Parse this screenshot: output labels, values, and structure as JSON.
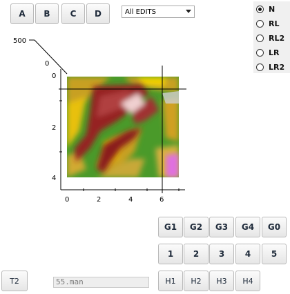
{
  "toolbar": {
    "buttons": [
      "A",
      "B",
      "C",
      "D"
    ]
  },
  "edits_dropdown": {
    "selected": "All EDITS"
  },
  "radio_group": {
    "options": [
      "N",
      "RL",
      "RL2",
      "LR",
      "LR2"
    ],
    "selected": "N"
  },
  "plot": {
    "z_label": "500",
    "z_zero": "0",
    "y_ticks": [
      "0",
      "2",
      "4"
    ],
    "x_ticks": [
      "0",
      "2",
      "4",
      "6"
    ]
  },
  "g_buttons": [
    "G1",
    "G2",
    "G3",
    "G4",
    "G0"
  ],
  "num_buttons": [
    "1",
    "2",
    "3",
    "4",
    "5"
  ],
  "h_buttons": [
    "H1",
    "H2",
    "H3",
    "H4"
  ],
  "t2_button": "T2",
  "status_field": "55.man"
}
